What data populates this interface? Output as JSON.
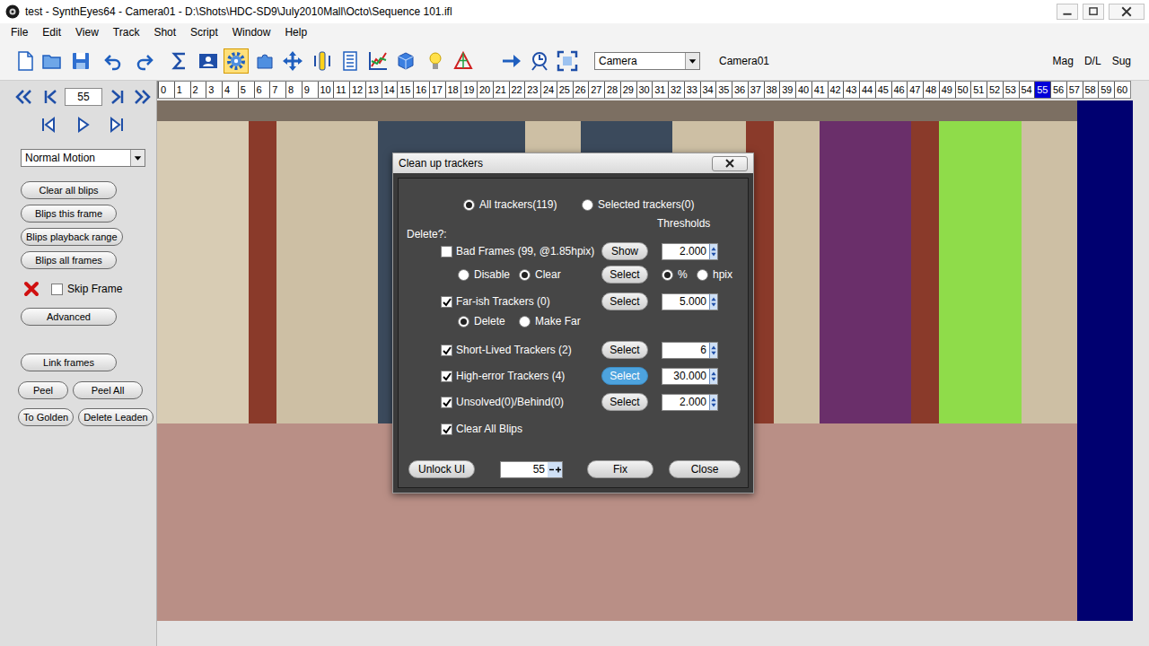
{
  "window": {
    "title": "test - SynthEyes64 - Camera01 - D:\\Shots\\HDC-SD9\\July2010Mall\\Octo\\Sequence 101.ifl"
  },
  "menu": [
    "File",
    "Edit",
    "View",
    "Track",
    "Shot",
    "Script",
    "Window",
    "Help"
  ],
  "toolbar": {
    "tools": [
      {
        "selected": false
      },
      {
        "selected": false
      },
      {
        "selected": false
      },
      {
        "selected": false
      },
      {
        "selected": false
      },
      {
        "selected": false
      },
      {
        "selected": false
      },
      {
        "selected": true
      },
      {
        "selected": false
      },
      {
        "selected": false
      },
      {
        "selected": false
      },
      {
        "selected": false
      },
      {
        "selected": false
      },
      {
        "selected": false
      },
      {
        "selected": false
      },
      {
        "selected": false
      },
      {
        "selected": false
      },
      {
        "selected": false
      },
      {
        "selected": false
      }
    ],
    "object_type": "Camera",
    "object_name": "Camera01",
    "right_labels": [
      "Mag",
      "D/L",
      "Sug"
    ]
  },
  "timeline": {
    "frames": [
      {
        "label": "0",
        "selected": false
      },
      {
        "label": "1",
        "selected": false
      },
      {
        "label": "2",
        "selected": false
      },
      {
        "label": "3",
        "selected": false
      },
      {
        "label": "4",
        "selected": false
      },
      {
        "label": "5",
        "selected": false
      },
      {
        "label": "6",
        "selected": false
      },
      {
        "label": "7",
        "selected": false
      },
      {
        "label": "8",
        "selected": false
      },
      {
        "label": "9",
        "selected": false
      },
      {
        "label": "10",
        "selected": false
      },
      {
        "label": "11",
        "selected": false
      },
      {
        "label": "12",
        "selected": false
      },
      {
        "label": "13",
        "selected": false
      },
      {
        "label": "14",
        "selected": false
      },
      {
        "label": "15",
        "selected": false
      },
      {
        "label": "16",
        "selected": false
      },
      {
        "label": "17",
        "selected": false
      },
      {
        "label": "18",
        "selected": false
      },
      {
        "label": "19",
        "selected": false
      },
      {
        "label": "20",
        "selected": false
      },
      {
        "label": "21",
        "selected": false
      },
      {
        "label": "22",
        "selected": false
      },
      {
        "label": "23",
        "selected": false
      },
      {
        "label": "24",
        "selected": false
      },
      {
        "label": "25",
        "selected": false
      },
      {
        "label": "26",
        "selected": false
      },
      {
        "label": "27",
        "selected": false
      },
      {
        "label": "28",
        "selected": false
      },
      {
        "label": "29",
        "selected": false
      },
      {
        "label": "30",
        "selected": false
      },
      {
        "label": "31",
        "selected": false
      },
      {
        "label": "32",
        "selected": false
      },
      {
        "label": "33",
        "selected": false
      },
      {
        "label": "34",
        "selected": false
      },
      {
        "label": "35",
        "selected": false
      },
      {
        "label": "36",
        "selected": false
      },
      {
        "label": "37",
        "selected": false
      },
      {
        "label": "38",
        "selected": false
      },
      {
        "label": "39",
        "selected": false
      },
      {
        "label": "40",
        "selected": false
      },
      {
        "label": "41",
        "selected": false
      },
      {
        "label": "42",
        "selected": false
      },
      {
        "label": "43",
        "selected": false
      },
      {
        "label": "44",
        "selected": false
      },
      {
        "label": "45",
        "selected": false
      },
      {
        "label": "46",
        "selected": false
      },
      {
        "label": "47",
        "selected": false
      },
      {
        "label": "48",
        "selected": false
      },
      {
        "label": "49",
        "selected": false
      },
      {
        "label": "50",
        "selected": false
      },
      {
        "label": "51",
        "selected": false
      },
      {
        "label": "52",
        "selected": false
      },
      {
        "label": "53",
        "selected": false
      },
      {
        "label": "54",
        "selected": false
      },
      {
        "label": "55",
        "selected": true
      },
      {
        "label": "56",
        "selected": false
      },
      {
        "label": "57",
        "selected": false
      },
      {
        "label": "58",
        "selected": false
      },
      {
        "label": "59",
        "selected": false
      },
      {
        "label": "60",
        "selected": false
      }
    ]
  },
  "left_panel": {
    "frame": "55",
    "mode": "Normal Motion",
    "blip_buttons": [
      "Clear all blips",
      "Blips this frame",
      "Blips playback range",
      "Blips all frames"
    ],
    "skip_frame": {
      "label": "Skip Frame",
      "checked": false
    },
    "advanced": "Advanced",
    "link_frames": "Link frames",
    "pairs": [
      [
        "Peel",
        "Peel All"
      ],
      [
        "To Golden",
        "Delete Leaden"
      ]
    ]
  },
  "dialog": {
    "title": "Clean up trackers",
    "scope": [
      {
        "label": "All trackers(119)",
        "selected": true
      },
      {
        "label": "Selected trackers(0)",
        "selected": false
      }
    ],
    "delete_label": "Delete?:",
    "thresholds_label": "Thresholds",
    "rows": [
      {
        "label": "Bad Frames (99, @1.85hpix)",
        "checked": false,
        "button": {
          "label": "Show",
          "highlighted": false
        },
        "value": "2.000",
        "sub": {
          "options": [
            {
              "label": "Disable",
              "selected": false
            },
            {
              "label": "Clear",
              "selected": true
            }
          ],
          "button": {
            "label": "Select",
            "highlighted": false
          },
          "units": [
            {
              "label": "%",
              "selected": true
            },
            {
              "label": "hpix",
              "selected": false
            }
          ]
        }
      },
      {
        "label": "Far-ish Trackers (0)",
        "checked": true,
        "button": {
          "label": "Select",
          "highlighted": false
        },
        "value": "5.000",
        "sub": {
          "options": [
            {
              "label": "Delete",
              "selected": true
            },
            {
              "label": "Make Far",
              "selected": false
            }
          ]
        }
      },
      {
        "label": "Short-Lived Trackers (2)",
        "checked": true,
        "button": {
          "label": "Select",
          "highlighted": false
        },
        "value": "6"
      },
      {
        "label": "High-error Trackers (4)",
        "checked": true,
        "button": {
          "label": "Select",
          "highlighted": true
        },
        "value": "30.000"
      },
      {
        "label": "Unsolved(0)/Behind(0)",
        "checked": true,
        "button": {
          "label": "Select",
          "highlighted": false
        },
        "value": "2.000"
      },
      {
        "label": "Clear All Blips",
        "checked": true
      }
    ],
    "bottom": {
      "unlock": "Unlock UI",
      "frame": "55",
      "fix": "Fix",
      "close": "Close"
    }
  }
}
